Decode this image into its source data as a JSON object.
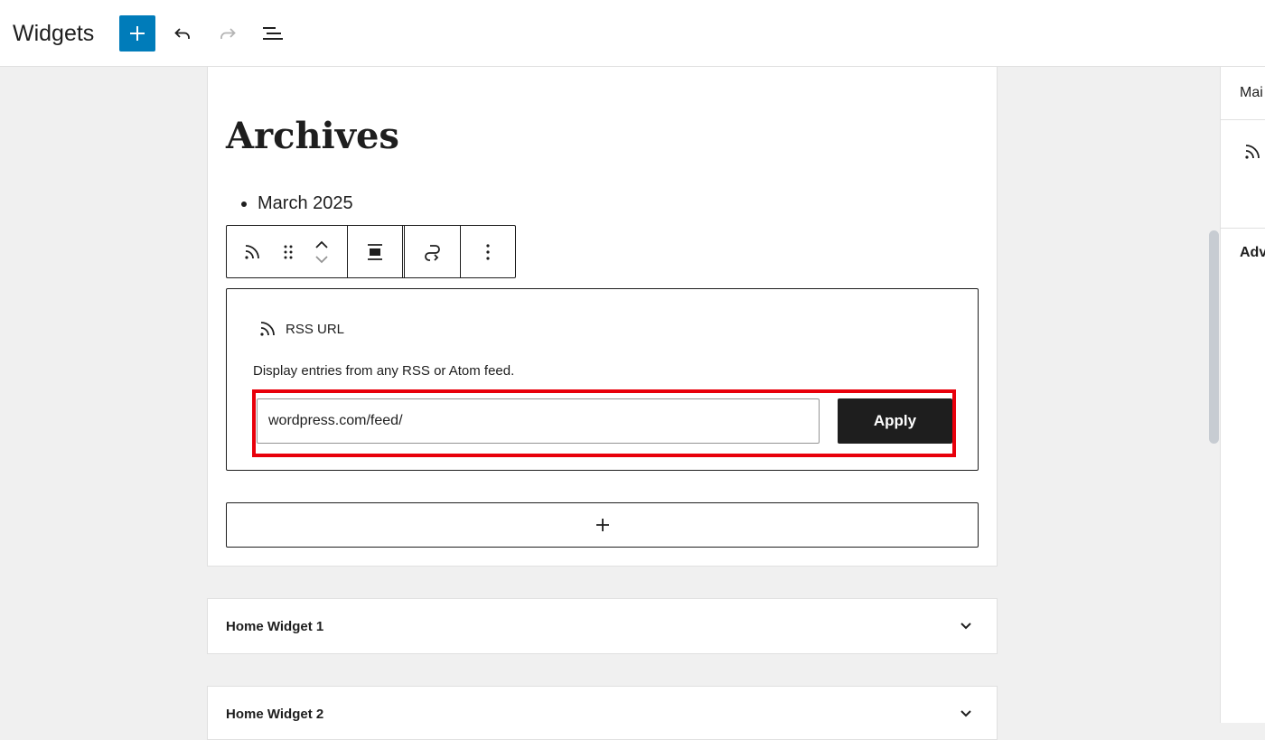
{
  "header": {
    "title": "Widgets"
  },
  "canvas": {
    "partial_text": "— — — — — — — — — —",
    "archives_heading": "Archives",
    "archive_items": [
      "March 2025"
    ]
  },
  "rss_block": {
    "label": "RSS URL",
    "description": "Display entries from any RSS or Atom feed.",
    "url_value": "wordpress.com/feed/",
    "apply_label": "Apply"
  },
  "widget_areas": [
    {
      "title": "Home Widget 1"
    },
    {
      "title": "Home Widget 2"
    }
  ],
  "sidebar": {
    "tab_label": "Mai",
    "advanced_label": "Adv"
  },
  "colors": {
    "accent": "#007cba",
    "highlight": "#e8000b",
    "dark": "#1e1e1e"
  }
}
